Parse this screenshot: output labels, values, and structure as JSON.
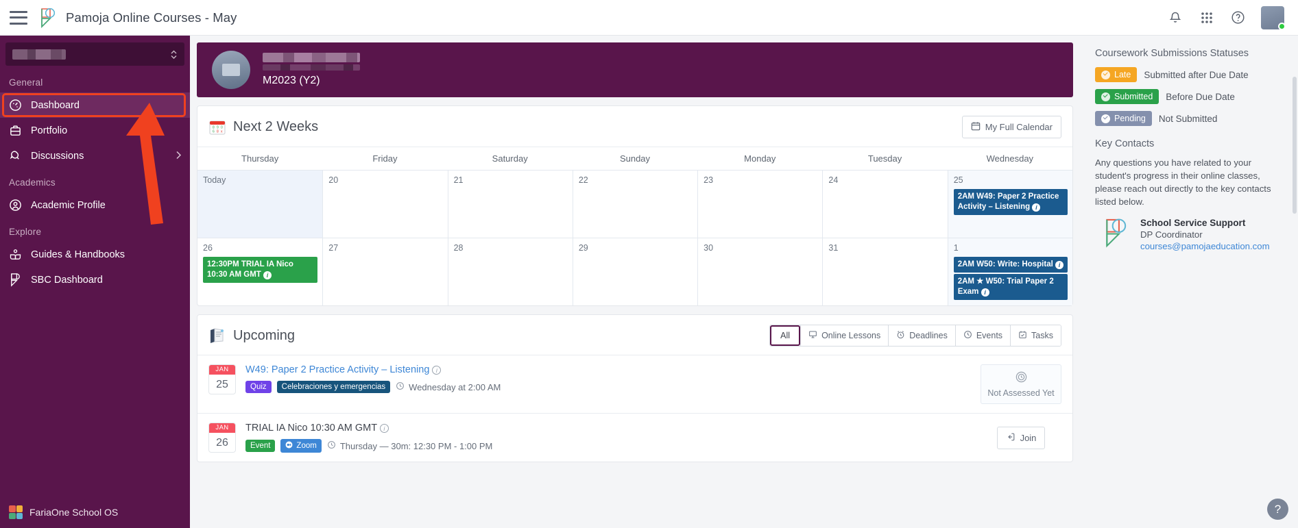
{
  "topbar": {
    "menu_icon": "hamburger-icon",
    "logo": "pamoja-logo",
    "title": "Pamoja Online Courses - May",
    "icons": [
      "bell-icon",
      "apps-grid-icon",
      "help-circle-icon"
    ],
    "avatar": "user-avatar"
  },
  "sidebar": {
    "school_selector_value": "",
    "sections": [
      {
        "label": "General",
        "items": [
          {
            "label": "Dashboard",
            "icon": "speedometer-icon",
            "active": true
          },
          {
            "label": "Portfolio",
            "icon": "briefcase-icon",
            "active": false
          },
          {
            "label": "Discussions",
            "icon": "chat-bubble-icon",
            "active": false,
            "chevron": "chevron-right-icon"
          }
        ]
      },
      {
        "label": "Academics",
        "items": [
          {
            "label": "Academic Profile",
            "icon": "user-circle-icon",
            "active": false
          }
        ]
      },
      {
        "label": "Explore",
        "items": [
          {
            "label": "Guides & Handbooks",
            "icon": "book-reader-icon",
            "active": false
          },
          {
            "label": "SBC Dashboard",
            "icon": "pamoja-flag-icon",
            "active": false
          }
        ]
      }
    ],
    "footer": {
      "label": "FariaOne School OS",
      "icon": "faria-logo-icon"
    }
  },
  "banner": {
    "course_name_redacted": "",
    "course_code": "M2023 (Y2)"
  },
  "calendar": {
    "title": "Next 2 Weeks",
    "title_icon": "calendar-emoji",
    "full_calendar_button": "My Full Calendar",
    "full_calendar_icon": "calendar-icon",
    "weekdays": [
      "Thursday",
      "Friday",
      "Saturday",
      "Sunday",
      "Monday",
      "Tuesday",
      "Wednesday"
    ],
    "weeks": [
      {
        "days": [
          {
            "label": "Today",
            "today": true,
            "events": []
          },
          {
            "label": "20",
            "events": []
          },
          {
            "label": "21",
            "events": []
          },
          {
            "label": "22",
            "events": []
          },
          {
            "label": "23",
            "events": []
          },
          {
            "label": "24",
            "events": []
          },
          {
            "label": "25",
            "highlight": true,
            "events": [
              {
                "text": "2AM W49: Paper 2 Practice Activity – Listening",
                "color": "blue",
                "info": true
              }
            ]
          }
        ]
      },
      {
        "days": [
          {
            "label": "26",
            "events": [
              {
                "text": "12:30PM TRIAL IA Nico 10:30 AM GMT",
                "color": "green",
                "info": true
              }
            ]
          },
          {
            "label": "27",
            "events": []
          },
          {
            "label": "28",
            "events": []
          },
          {
            "label": "29",
            "events": []
          },
          {
            "label": "30",
            "events": []
          },
          {
            "label": "31",
            "events": []
          },
          {
            "label": "1",
            "highlight": true,
            "events": [
              {
                "text": "2AM W50: Write: Hospital",
                "color": "blue",
                "info": true
              },
              {
                "text": "2AM ★ W50: Trial Paper 2 Exam",
                "color": "blue",
                "info": true
              }
            ]
          }
        ]
      }
    ]
  },
  "upcoming": {
    "title": "Upcoming",
    "title_icon": "books-emoji",
    "filters": [
      {
        "label": "All",
        "icon": null,
        "active": true
      },
      {
        "label": "Online Lessons",
        "icon": "presentation-icon",
        "active": false
      },
      {
        "label": "Deadlines",
        "icon": "alarm-icon",
        "active": false
      },
      {
        "label": "Events",
        "icon": "clock-icon",
        "active": false
      },
      {
        "label": "Tasks",
        "icon": "task-icon",
        "active": false
      }
    ],
    "items": [
      {
        "month": "JAN",
        "day": "25",
        "title": "W49: Paper 2 Practice Activity – Listening",
        "tags": [
          {
            "label": "Quiz",
            "style": "quiz"
          },
          {
            "label": "Celebraciones y emergencias",
            "style": "subject"
          }
        ],
        "when": "Wednesday at 2:00 AM",
        "when_icon": "clock-icon",
        "right": {
          "type": "status",
          "label": "Not Assessed Yet",
          "icon": "clock-circle-icon"
        }
      },
      {
        "month": "JAN",
        "day": "26",
        "title": "TRIAL IA Nico 10:30 AM GMT",
        "tags": [
          {
            "label": "Event",
            "style": "event"
          },
          {
            "label": "Zoom",
            "style": "zoom",
            "icon": "zoom-icon"
          }
        ],
        "when": "Thursday — 30m: 12:30 PM - 1:00 PM",
        "when_icon": "clock-icon",
        "right": {
          "type": "button",
          "label": "Join",
          "icon": "join-arrow-icon"
        }
      }
    ]
  },
  "right_panel": {
    "statuses_title": "Coursework Submissions Statuses",
    "statuses": [
      {
        "pill": "Late",
        "style": "late",
        "desc": "Submitted after Due Date"
      },
      {
        "pill": "Submitted",
        "style": "submitted",
        "desc": "Before Due Date"
      },
      {
        "pill": "Pending",
        "style": "pending",
        "desc": "Not Submitted"
      }
    ],
    "key_contacts_title": "Key Contacts",
    "key_contacts_desc": "Any questions you have related to your student's progress in their online classes, please reach out directly to the key contacts listed below.",
    "contact": {
      "logo": "pamoja-logo-icon",
      "name": "School Service Support",
      "role": "DP Coordinator",
      "email": "courses@pamojaeducation.com"
    }
  },
  "help_fab": {
    "label": "?",
    "icon": "question-mark-icon"
  },
  "colors": {
    "sidebar_purple": "#59154b",
    "annotation_red": "#f0411f",
    "link_blue": "#3e87d6",
    "event_blue": "#1b5b8f",
    "event_green": "#2aa14a"
  }
}
